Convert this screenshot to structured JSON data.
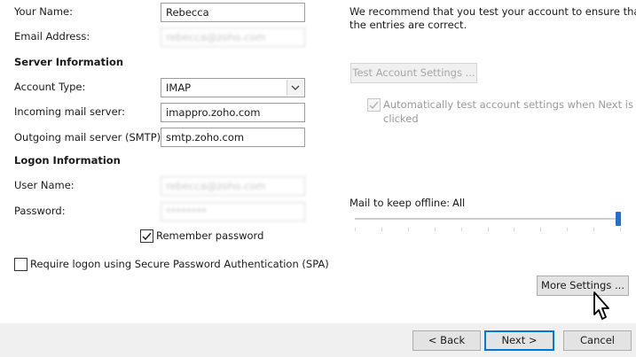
{
  "user_info": {
    "your_name_label": "Your Name:",
    "your_name_value": "Rebecca",
    "email_label": "Email Address:",
    "email_value": "rebecca@zoho.com"
  },
  "server_info": {
    "heading": "Server Information",
    "account_type_label": "Account Type:",
    "account_type_value": "IMAP",
    "incoming_label": "Incoming mail server:",
    "incoming_value": "imappro.zoho.com",
    "outgoing_label": "Outgoing mail server (SMTP):",
    "outgoing_value": "smtp.zoho.com"
  },
  "logon_info": {
    "heading": "Logon Information",
    "user_name_label": "User Name:",
    "user_name_value": "rebecca@zoho.com",
    "password_label": "Password:",
    "password_value": "********",
    "remember_password_label": "Remember password",
    "remember_password_checked": true,
    "spa_label": "Require logon using Secure Password Authentication (SPA)",
    "spa_checked": false
  },
  "test_settings": {
    "recommend_line1": "We recommend that you test your account to ensure that",
    "recommend_line2": "the entries are correct.",
    "test_button_label": "Test Account Settings ...",
    "auto_test_line1": "Automatically test account settings when Next is",
    "auto_test_line2": "clicked",
    "auto_test_checked": true
  },
  "offline": {
    "label": "Mail to keep offline:",
    "value": "All",
    "slider_fraction": 1.0
  },
  "buttons": {
    "more_settings": "More Settings ...",
    "back": "< Back",
    "next": "Next >",
    "cancel": "Cancel"
  },
  "colors": {
    "focus_blue": "#0078d7",
    "button_face": "#e3e3e3",
    "footer": "#f0f0f0"
  },
  "icons": {
    "select_arrow": "chevron-down-icon",
    "checkmark": "checkmark-icon",
    "cursor": "mouse-pointer-icon"
  }
}
